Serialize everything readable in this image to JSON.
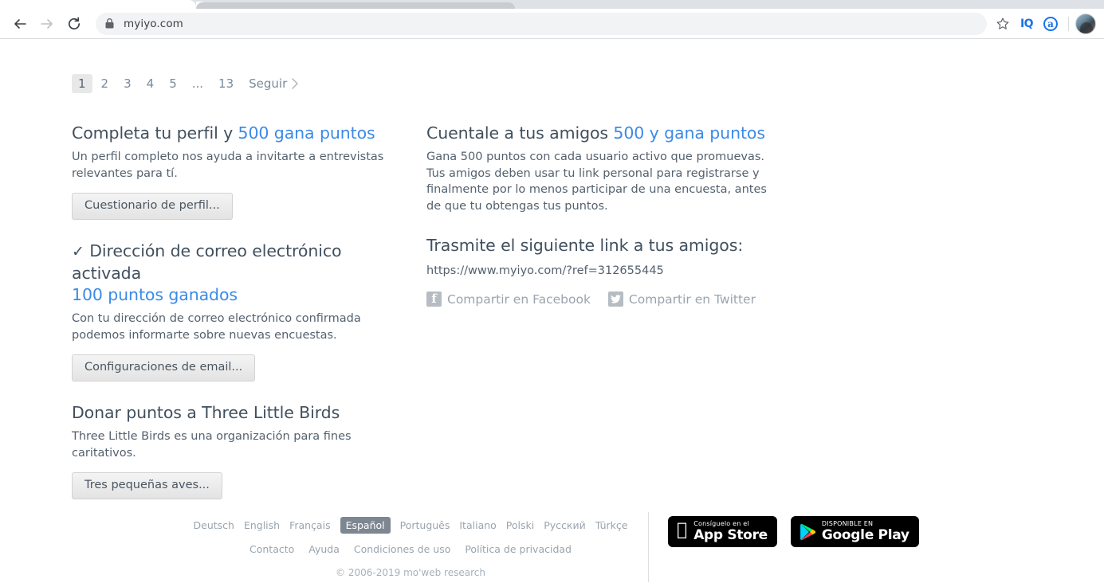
{
  "browser": {
    "url": "myiyo.com",
    "back_label": "Back",
    "forward_label": "Forward",
    "reload_label": "Reload",
    "lock_icon": "lock-icon",
    "bookmark_icon": "star-icon",
    "extensions": [
      {
        "name": "iq-extension-icon",
        "label": "IQ"
      },
      {
        "name": "alexa-extension-icon",
        "label": "a"
      }
    ],
    "avatar_label": "Profile"
  },
  "pagination": {
    "pages": [
      "1",
      "2",
      "3",
      "4",
      "5",
      "...",
      "13"
    ],
    "active_index": 0,
    "next_label": "Seguir",
    "next_icon": "chevron-right-icon"
  },
  "left_column": [
    {
      "title_plain": "Completa tu perfil y ",
      "title_highlight": "500 gana puntos",
      "body": "Un perfil completo nos ayuda a invitarte a entrevistas relevantes para tí.",
      "button": "Cuestionario de perfil..."
    },
    {
      "check": "✓",
      "title_plain": " Dirección de correo electrónico activada",
      "title_highlight": "100 puntos ganados",
      "body": "Con tu dirección de correo electrónico confirmada podemos informarte sobre nuevas encuestas.",
      "button": "Configuraciones de email..."
    },
    {
      "title_plain": "Donar puntos a Three Little Birds",
      "title_highlight": "",
      "body": "Three Little Birds es una organización para fines caritativos.",
      "button": "Tres pequeñas aves..."
    }
  ],
  "right_column": {
    "title_plain": "Cuentale a tus amigos ",
    "title_highlight": "500 y gana puntos",
    "body": "Gana 500 puntos con cada usuario activo que promuevas. Tus amigos deben usar tu link personal para registrarse y finalmente por lo menos participar de una encuesta, antes de que tu obtengas tus puntos.",
    "link_title": "Trasmite el siguiente link a tus amigos:",
    "referral_url": "https://www.myiyo.com/?ref=312655445",
    "share_facebook": "Compartir en Facebook",
    "share_twitter": "Compartir en Twitter"
  },
  "footer": {
    "languages": [
      "Deutsch",
      "English",
      "Français",
      "Español",
      "Português",
      "Italiano",
      "Polski",
      "Русский",
      "Türkçe"
    ],
    "selected_language": "Español",
    "links": [
      "Contacto",
      "Ayuda",
      "Condiciones de uso",
      "Política de privacidad"
    ],
    "copyright": "© 2006-2019  mo'web research",
    "app_store": {
      "small": "Consíguelo en el",
      "big": "App Store",
      "icon": "apple-icon"
    },
    "google_play": {
      "small": "DISPONIBLE EN",
      "big": "Google Play",
      "icon": "google-play-icon"
    }
  },
  "colors": {
    "link_blue": "#3b8ae8",
    "heading": "#41505e",
    "body_text": "#54616e",
    "muted": "#9aa4ae",
    "browser_accent": "#1a73e8"
  }
}
